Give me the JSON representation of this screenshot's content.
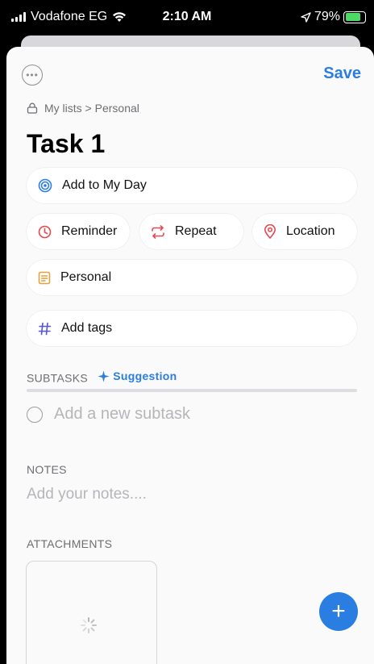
{
  "status_bar": {
    "carrier": "Vodafone EG",
    "time": "2:10 AM",
    "battery": "79%",
    "battery_level": 0.79
  },
  "header": {
    "more_icon": "ellipsis-circle-icon",
    "save_label": "Save"
  },
  "breadcrumb": {
    "text": "My lists > Personal",
    "icon": "lock-icon"
  },
  "task": {
    "title": "Task 1"
  },
  "actions": {
    "my_day": {
      "label": "Add to My Day",
      "icon": "target-icon",
      "color": "#2a7de1"
    },
    "reminder": {
      "label": "Reminder",
      "icon": "clock-icon",
      "color": "#e5484d"
    },
    "repeat": {
      "label": "Repeat",
      "icon": "repeat-icon",
      "color": "#e5484d"
    },
    "location": {
      "label": "Location",
      "icon": "location-pin-icon",
      "color": "#e5484d"
    },
    "list": {
      "label": "Personal",
      "icon": "note-icon",
      "color": "#e6a23c"
    },
    "tags": {
      "label": "Add tags",
      "icon": "hashtag-icon",
      "color": "#5856d6"
    }
  },
  "subtasks": {
    "header": "SUBTASKS",
    "suggestion_label": "Suggestion",
    "placeholder": "Add a new subtask"
  },
  "notes": {
    "header": "NOTES",
    "placeholder": "Add your notes...."
  },
  "attachments": {
    "header": "ATTACHMENTS"
  },
  "fab": {
    "label": "+",
    "color": "#2a7de1"
  }
}
